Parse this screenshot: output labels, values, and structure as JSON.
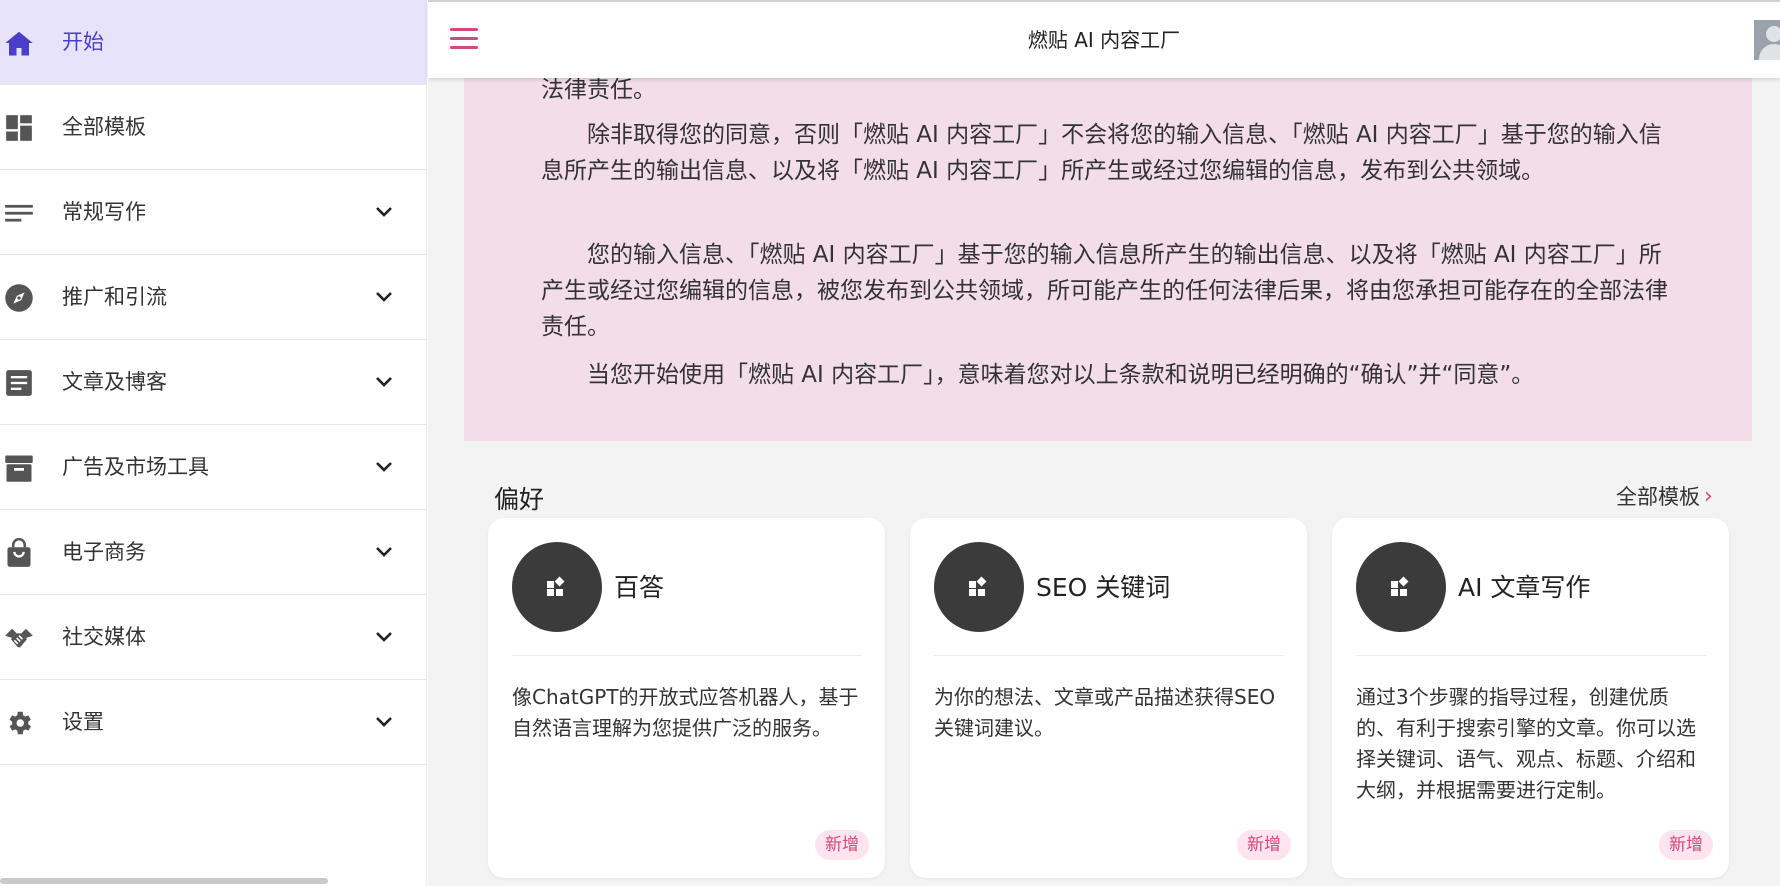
{
  "app": {
    "title": "燃贴 AI 内容工厂"
  },
  "sidebar": {
    "items": [
      {
        "label": "开始",
        "icon": "home-icon"
      },
      {
        "label": "全部模板",
        "icon": "dashboard-icon"
      },
      {
        "label": "常规写作",
        "icon": "lines-icon"
      },
      {
        "label": "推广和引流",
        "icon": "compass-icon"
      },
      {
        "label": "文章及博客",
        "icon": "article-icon"
      },
      {
        "label": "广告及市场工具",
        "icon": "archive-icon"
      },
      {
        "label": "电子商务",
        "icon": "shopping-bag-icon"
      },
      {
        "label": "社交媒体",
        "icon": "handshake-icon"
      },
      {
        "label": "设置",
        "icon": "gear-icon"
      }
    ]
  },
  "notice": {
    "paragraphs": [
      "法律责任。",
      "　　除非取得您的同意，否则「燃贴 AI 内容工厂」不会将您的输入信息、「燃贴 AI 内容工厂」基于您的输入信息所产生的输出信息、以及将「燃贴 AI 内容工厂」所产生或经过您编辑的信息，发布到公共领域。",
      "　　您的输入信息、「燃贴 AI 内容工厂」基于您的输入信息所产生的输出信息、以及将「燃贴 AI 内容工厂」所产生或经过您编辑的信息，被您发布到公共领域，所可能产生的任何法律后果，将由您承担可能存在的全部法律责任。",
      "　　当您开始使用「燃贴 AI 内容工厂」，意味着您对以上条款和说明已经明确的“确认”并“同意”。"
    ]
  },
  "preferences": {
    "title": "偏好",
    "all_link": "全部模板",
    "arrow": "›",
    "cards": [
      {
        "title": "百答",
        "desc": "像ChatGPT的开放式应答机器人，基于自然语言理解为您提供广泛的服务。",
        "badge": "新增"
      },
      {
        "title": "SEO 关键词",
        "desc": "为你的想法、文章或产品描述获得SEO关键词建议。",
        "badge": "新增"
      },
      {
        "title": "AI 文章写作",
        "desc": "通过3个步骤的指导过程，创建优质的、有利于搜索引擎的文章。你可以选择关键词、语气、观点、标题、介绍和大纲，并根据需要进行定制。",
        "badge": "新增"
      }
    ]
  },
  "colors": {
    "accent": "#4b3fc7",
    "brand_pink": "#d6457b",
    "notice_bg": "#f2dde8",
    "active_bg": "#e6e3fb"
  }
}
